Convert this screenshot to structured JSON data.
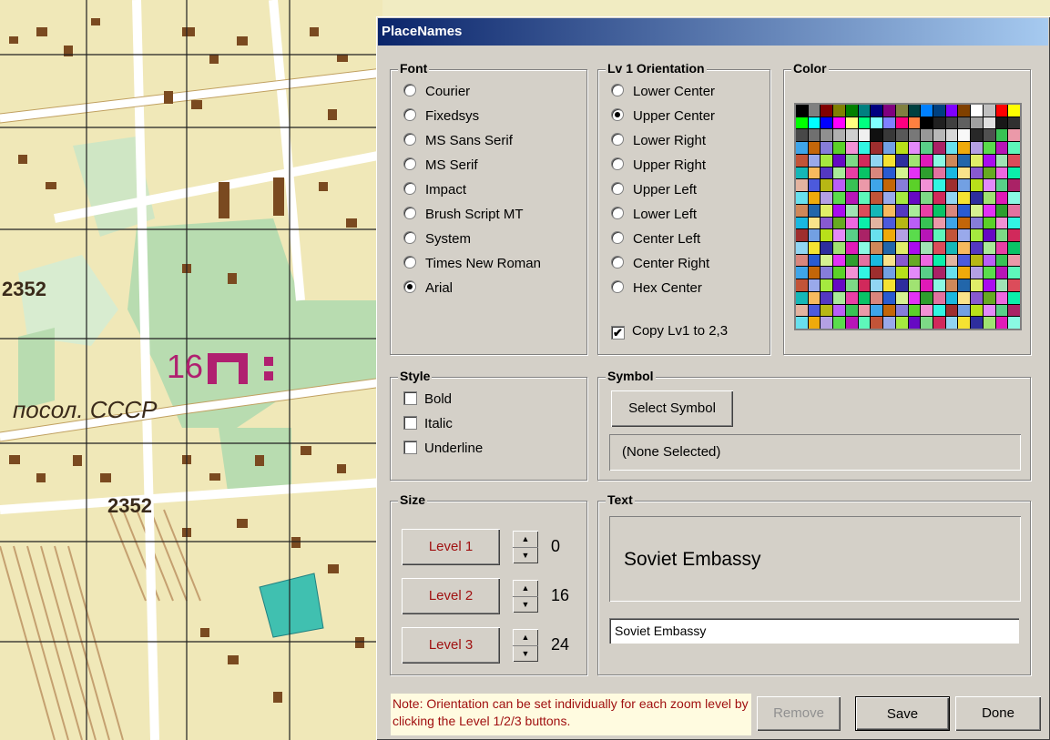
{
  "map": {
    "labels": [
      "2352",
      "16",
      "посол. СССР",
      "2352"
    ]
  },
  "dialog": {
    "title": "PlaceNames",
    "font_group": {
      "legend": "Font",
      "options": [
        "Courier",
        "Fixedsys",
        "MS Sans Serif",
        "MS Serif",
        "Impact",
        "Brush Script MT",
        "System",
        "Times New Roman",
        "Arial"
      ],
      "selected": "Arial"
    },
    "orientation_group": {
      "legend": "Lv 1 Orientation",
      "options": [
        "Lower Center",
        "Upper Center",
        "Lower Right",
        "Upper Right",
        "Upper Left",
        "Lower Left",
        "Center Left",
        "Center Right",
        "Hex Center"
      ],
      "selected": "Upper Center",
      "copy_checkbox_label": "Copy Lv1 to 2,3",
      "copy_checked": true
    },
    "color_group": {
      "legend": "Color",
      "palette": [
        "#000000",
        "#808080",
        "#800000",
        "#808000",
        "#008000",
        "#008080",
        "#000080",
        "#800080",
        "#808040",
        "#004040",
        "#0080ff",
        "#004080",
        "#8000ff",
        "#804000",
        "#ffffff",
        "#c0c0c0",
        "#ff0000",
        "#ffff00",
        "#00ff00",
        "#00ffff",
        "#0000ff",
        "#ff00ff",
        "#ffff80",
        "#00ff80",
        "#80ffff",
        "#8080ff",
        "#ff0080",
        "#ff8040",
        "#000000",
        "#202020",
        "#404040",
        "#606060",
        "#a0a0a0",
        "#e0e0e0",
        "#181818",
        "#303030",
        "#484848",
        "#707070",
        "#909090",
        "#b0b0b0",
        "#d0d0d0",
        "#f0f0f0",
        "#101010",
        "#383838",
        "#585858",
        "#787878",
        "#989898",
        "#b8b8b8",
        "#d8d8d8",
        "#f8f8f8",
        "#282828",
        "#505050"
      ]
    },
    "style_group": {
      "legend": "Style",
      "options": [
        {
          "label": "Bold",
          "checked": false
        },
        {
          "label": "Italic",
          "checked": false
        },
        {
          "label": "Underline",
          "checked": false
        }
      ]
    },
    "symbol_group": {
      "legend": "Symbol",
      "select_button": "Select Symbol",
      "selected_text": "(None Selected)"
    },
    "size_group": {
      "legend": "Size",
      "levels": [
        {
          "label": "Level 1",
          "value": "0"
        },
        {
          "label": "Level 2",
          "value": "16"
        },
        {
          "label": "Level 3",
          "value": "24"
        }
      ]
    },
    "text_group": {
      "legend": "Text",
      "preview": "Soviet Embassy",
      "input_value": "Soviet Embassy"
    },
    "note": "Note: Orientation can be set individually for each zoom level by clicking the Level 1/2/3 buttons.",
    "buttons": {
      "remove": "Remove",
      "save": "Save",
      "done": "Done"
    }
  }
}
